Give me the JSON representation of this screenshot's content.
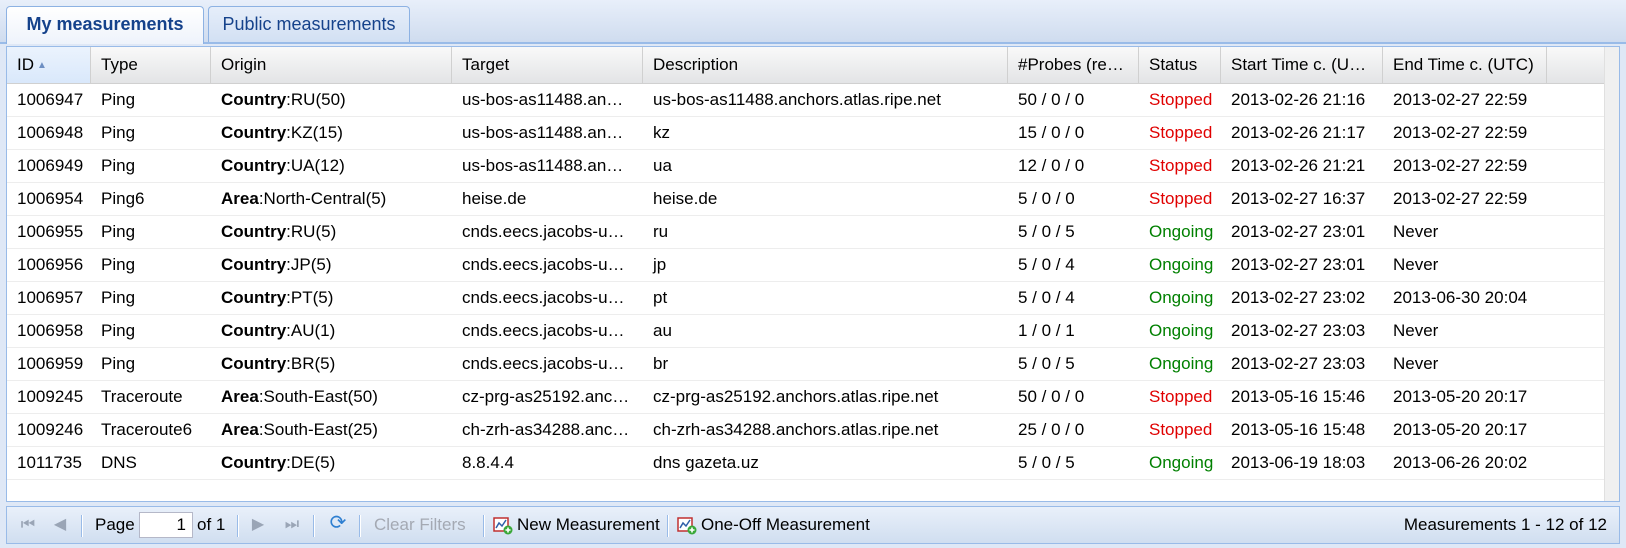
{
  "tabs": [
    {
      "label": "My measurements"
    },
    {
      "label": "Public measurements"
    }
  ],
  "columns": [
    "ID",
    "Type",
    "Origin",
    "Target",
    "Description",
    "#Probes (re…",
    "Status",
    "Start Time c. (U…",
    "End Time c. (UTC)"
  ],
  "rows": [
    {
      "id": "1006947",
      "type": "Ping",
      "origin_key": "Country",
      "origin_val": ":RU(50)",
      "target": "us-bos-as11488.an…",
      "description": "us-bos-as11488.anchors.atlas.ripe.net",
      "probes": "50 / 0 / 0",
      "status": "Stopped",
      "start": "2013-02-26 21:16",
      "end": "2013-02-27 22:59"
    },
    {
      "id": "1006948",
      "type": "Ping",
      "origin_key": "Country",
      "origin_val": ":KZ(15)",
      "target": "us-bos-as11488.an…",
      "description": "kz",
      "probes": "15 / 0 / 0",
      "status": "Stopped",
      "start": "2013-02-26 21:17",
      "end": "2013-02-27 22:59"
    },
    {
      "id": "1006949",
      "type": "Ping",
      "origin_key": "Country",
      "origin_val": ":UA(12)",
      "target": "us-bos-as11488.an…",
      "description": "ua",
      "probes": "12 / 0 / 0",
      "status": "Stopped",
      "start": "2013-02-26 21:21",
      "end": "2013-02-27 22:59"
    },
    {
      "id": "1006954",
      "type": "Ping6",
      "origin_key": "Area",
      "origin_val": ":North-Central(5)",
      "target": "heise.de",
      "description": "heise.de",
      "probes": "5 / 0 / 0",
      "status": "Stopped",
      "start": "2013-02-27 16:37",
      "end": "2013-02-27 22:59"
    },
    {
      "id": "1006955",
      "type": "Ping",
      "origin_key": "Country",
      "origin_val": ":RU(5)",
      "target": "cnds.eecs.jacobs-u…",
      "description": "ru",
      "probes": "5 / 0 / 5",
      "status": "Ongoing",
      "start": "2013-02-27 23:01",
      "end": "Never"
    },
    {
      "id": "1006956",
      "type": "Ping",
      "origin_key": "Country",
      "origin_val": ":JP(5)",
      "target": "cnds.eecs.jacobs-u…",
      "description": "jp",
      "probes": "5 / 0 / 4",
      "status": "Ongoing",
      "start": "2013-02-27 23:01",
      "end": "Never"
    },
    {
      "id": "1006957",
      "type": "Ping",
      "origin_key": "Country",
      "origin_val": ":PT(5)",
      "target": "cnds.eecs.jacobs-u…",
      "description": "pt",
      "probes": "5 / 0 / 4",
      "status": "Ongoing",
      "start": "2013-02-27 23:02",
      "end": "2013-06-30 20:04"
    },
    {
      "id": "1006958",
      "type": "Ping",
      "origin_key": "Country",
      "origin_val": ":AU(1)",
      "target": "cnds.eecs.jacobs-u…",
      "description": "au",
      "probes": "1 / 0 / 1",
      "status": "Ongoing",
      "start": "2013-02-27 23:03",
      "end": "Never"
    },
    {
      "id": "1006959",
      "type": "Ping",
      "origin_key": "Country",
      "origin_val": ":BR(5)",
      "target": "cnds.eecs.jacobs-u…",
      "description": "br",
      "probes": "5 / 0 / 5",
      "status": "Ongoing",
      "start": "2013-02-27 23:03",
      "end": "Never"
    },
    {
      "id": "1009245",
      "type": "Traceroute",
      "origin_key": "Area",
      "origin_val": ":South-East(50)",
      "target": "cz-prg-as25192.anc…",
      "description": "cz-prg-as25192.anchors.atlas.ripe.net",
      "probes": "50 / 0 / 0",
      "status": "Stopped",
      "start": "2013-05-16 15:46",
      "end": "2013-05-20 20:17"
    },
    {
      "id": "1009246",
      "type": "Traceroute6",
      "origin_key": "Area",
      "origin_val": ":South-East(25)",
      "target": "ch-zrh-as34288.anc…",
      "description": "ch-zrh-as34288.anchors.atlas.ripe.net",
      "probes": "25 / 0 / 0",
      "status": "Stopped",
      "start": "2013-05-16 15:48",
      "end": "2013-05-20 20:17"
    },
    {
      "id": "1011735",
      "type": "DNS",
      "origin_key": "Country",
      "origin_val": ":DE(5)",
      "target": "8.8.4.4",
      "description": "dns gazeta.uz",
      "probes": "5 / 0 / 5",
      "status": "Ongoing",
      "start": "2013-06-19 18:03",
      "end": "2013-06-26 20:02"
    }
  ],
  "status_colors": {
    "Stopped": "#e00000",
    "Ongoing": "#008000"
  },
  "toolbar": {
    "page_label": "Page",
    "page_value": "1",
    "of_label": "of 1",
    "clear_filters": "Clear Filters",
    "new_measurement": "New Measurement",
    "one_off_measurement": "One-Off Measurement",
    "summary": "Measurements 1 - 12 of 12",
    "icons": [
      "first-page-icon",
      "prev-page-icon",
      "next-page-icon",
      "last-page-icon",
      "refresh-icon",
      "new-measurement-icon",
      "one-off-measurement-icon"
    ]
  }
}
